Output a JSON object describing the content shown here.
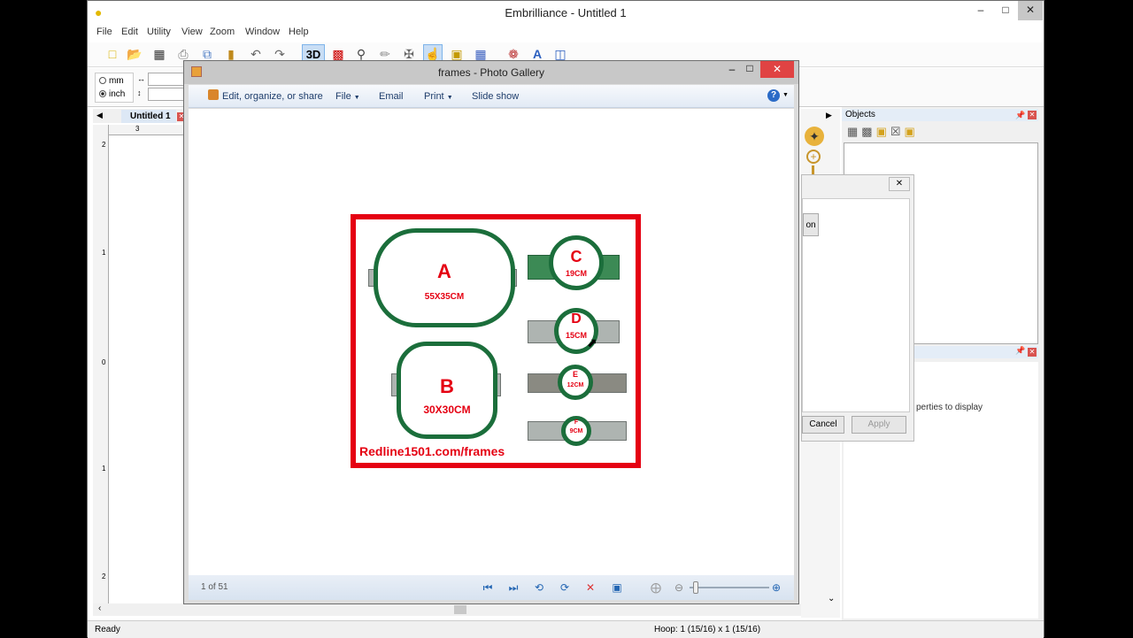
{
  "app": {
    "title": "Embrilliance  -  Untitled 1",
    "menu": [
      "File",
      "Edit",
      "Utility",
      "View",
      "Zoom",
      "Window",
      "Help"
    ],
    "units": {
      "mm_label": "mm",
      "inch_label": "inch",
      "selected": "inch"
    },
    "doc_tab": "Untitled 1",
    "ruler_marks": [
      "2",
      "3",
      "1",
      "0",
      "1",
      "2"
    ],
    "toolbar_3d": "3D",
    "status_left": "Ready",
    "status_right": "Hoop: 1 (15/16) x 1 (15/16)"
  },
  "objects_panel": {
    "title": "Objects"
  },
  "properties_panel": {
    "message": "perties to display"
  },
  "dialog": {
    "button_partial": "on",
    "cancel": "Cancel",
    "apply": "Apply"
  },
  "gallery": {
    "title": "frames - Photo Gallery",
    "commands": {
      "edit": "Edit, organize, or share",
      "file": "File",
      "email": "Email",
      "print": "Print",
      "slideshow": "Slide show"
    },
    "position": "1 of 51",
    "photo": {
      "hoops": [
        {
          "letter": "A",
          "size": "55X35CM"
        },
        {
          "letter": "B",
          "size": "30X30CM"
        },
        {
          "letter": "C",
          "size": "19CM"
        },
        {
          "letter": "D",
          "size": "15CM"
        },
        {
          "letter": "E",
          "size": "12CM"
        },
        {
          "letter": "F",
          "size": "9CM"
        }
      ],
      "caption": "Redline1501.com/frames"
    }
  },
  "colors": {
    "accent_red": "#e50012",
    "hoop_green": "#1b6e3b",
    "close_red": "#e04343"
  }
}
